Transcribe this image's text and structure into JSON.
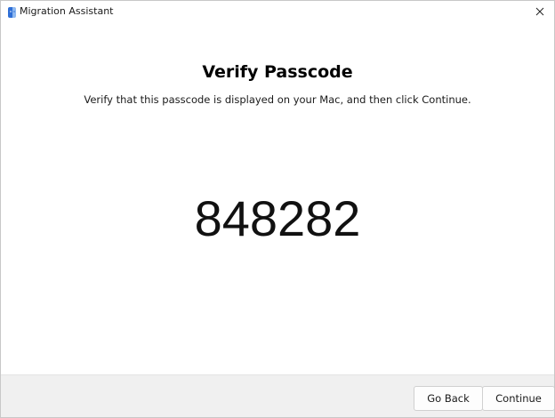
{
  "window": {
    "title": "Migration Assistant",
    "app_icon": "migration-assistant-icon",
    "close_icon": "close-icon"
  },
  "main": {
    "heading": "Verify Passcode",
    "instruction": "Verify that this passcode is displayed on your Mac, and then click Continue.",
    "passcode": "848282"
  },
  "footer": {
    "back_label": "Go Back",
    "continue_label": "Continue"
  },
  "colors": {
    "footer_background": "#f0f0f0",
    "window_background": "#ffffff"
  }
}
